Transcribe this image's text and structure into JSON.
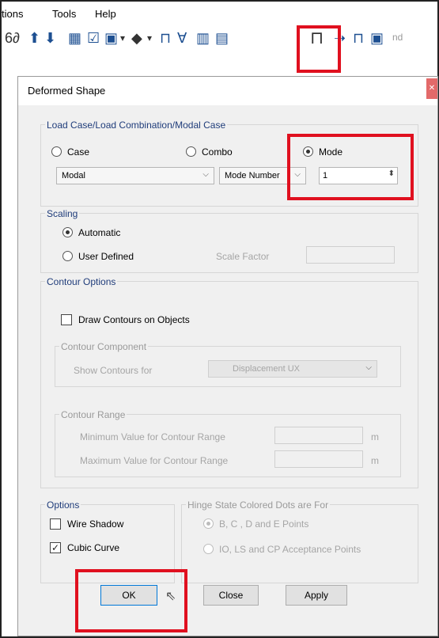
{
  "menu": {
    "items": [
      "tions",
      "Tools",
      "Help"
    ]
  },
  "toolbar": {
    "trailing_text": "nd"
  },
  "dialog": {
    "title": "Deformed Shape",
    "close_icon": "close-icon",
    "load_case": {
      "legend": "Load Case/Load Combination/Modal Case",
      "case_label": "Case",
      "combo_label": "Combo",
      "mode_label": "Mode",
      "selected": "Mode",
      "case_dropdown_value": "Modal",
      "mode_dropdown_value": "Mode Number",
      "mode_number": "1"
    },
    "scaling": {
      "legend": "Scaling",
      "automatic_label": "Automatic",
      "user_defined_label": "User Defined",
      "selected": "Automatic",
      "scale_factor_label": "Scale Factor",
      "scale_factor_value": ""
    },
    "contour_options": {
      "legend": "Contour Options",
      "draw_contours_label": "Draw Contours on Objects",
      "draw_contours_checked": false,
      "component": {
        "legend": "Contour Component",
        "show_for_label": "Show Contours for",
        "show_for_value": "Displacement UX"
      },
      "range": {
        "legend": "Contour Range",
        "min_label": "Minimum Value for Contour Range",
        "max_label": "Maximum Value for Contour Range",
        "min_unit": "m",
        "max_unit": "m",
        "min_value": "",
        "max_value": ""
      }
    },
    "options": {
      "legend": "Options",
      "wire_shadow_label": "Wire Shadow",
      "wire_shadow_checked": false,
      "cubic_curve_label": "Cubic Curve",
      "cubic_curve_checked": true
    },
    "hinge_state": {
      "legend": "Hinge State Colored Dots are For",
      "option1_label": "B, C , D and E Points",
      "option2_label": "IO, LS and CP Acceptance Points",
      "selected": "B, C , D and E Points"
    },
    "buttons": {
      "ok": "OK",
      "close": "Close",
      "apply": "Apply"
    }
  },
  "highlight_color": "#e0101f"
}
